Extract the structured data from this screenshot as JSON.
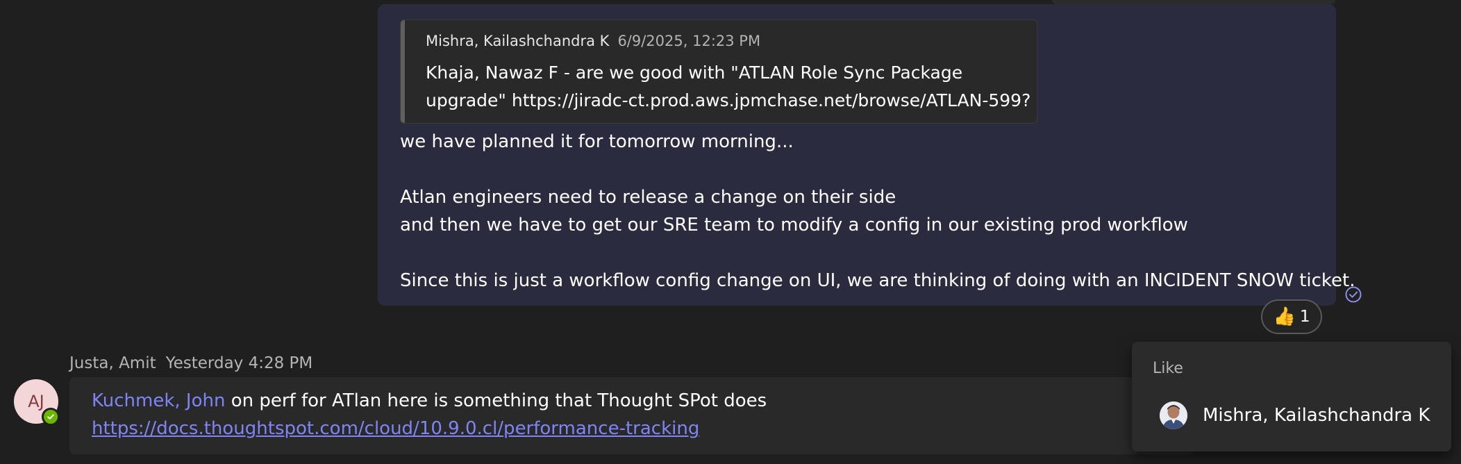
{
  "quoted_message": {
    "author": "Mishra, Kailashchandra K",
    "timestamp": "6/9/2025, 12:23 PM",
    "lines": [
      "Khaja, Nawaz F - are we good with \"ATLAN Role Sync Package",
      "upgrade\" https://jiradc-ct.prod.aws.jpmchase.net/browse/ATLAN-599?"
    ]
  },
  "my_message": {
    "lines": [
      "we have planned it for tomorrow morning...",
      "",
      "Atlan engineers need to release a change on their side",
      "and then we have to get our SRE team to modify a config in our existing prod workflow",
      "",
      "Since this is just a workflow config change on UI, we are thinking of doing with an INCIDENT SNOW ticket."
    ],
    "read_receipt_icon": "seen-check-icon",
    "accent_color": "#2b2b40"
  },
  "reaction": {
    "emoji": "👍",
    "icon": "thumbs-up-icon",
    "count": "1"
  },
  "next_message": {
    "sender": "Justa, Amit",
    "timestamp": "Yesterday 4:28 PM",
    "avatar_initials": "AJ",
    "presence": "available",
    "presence_color": "#6bb700",
    "mention": "Kuchmek, John",
    "text": " on perf for ATlan  here is something that Thought SPot does",
    "link": "https://docs.thoughtspot.com/cloud/10.9.0.cl/performance-tracking",
    "link_color": "#7f85f5"
  },
  "like_popup": {
    "title": "Like",
    "users": [
      {
        "name": "Mishra, Kailashchandra K"
      }
    ]
  }
}
